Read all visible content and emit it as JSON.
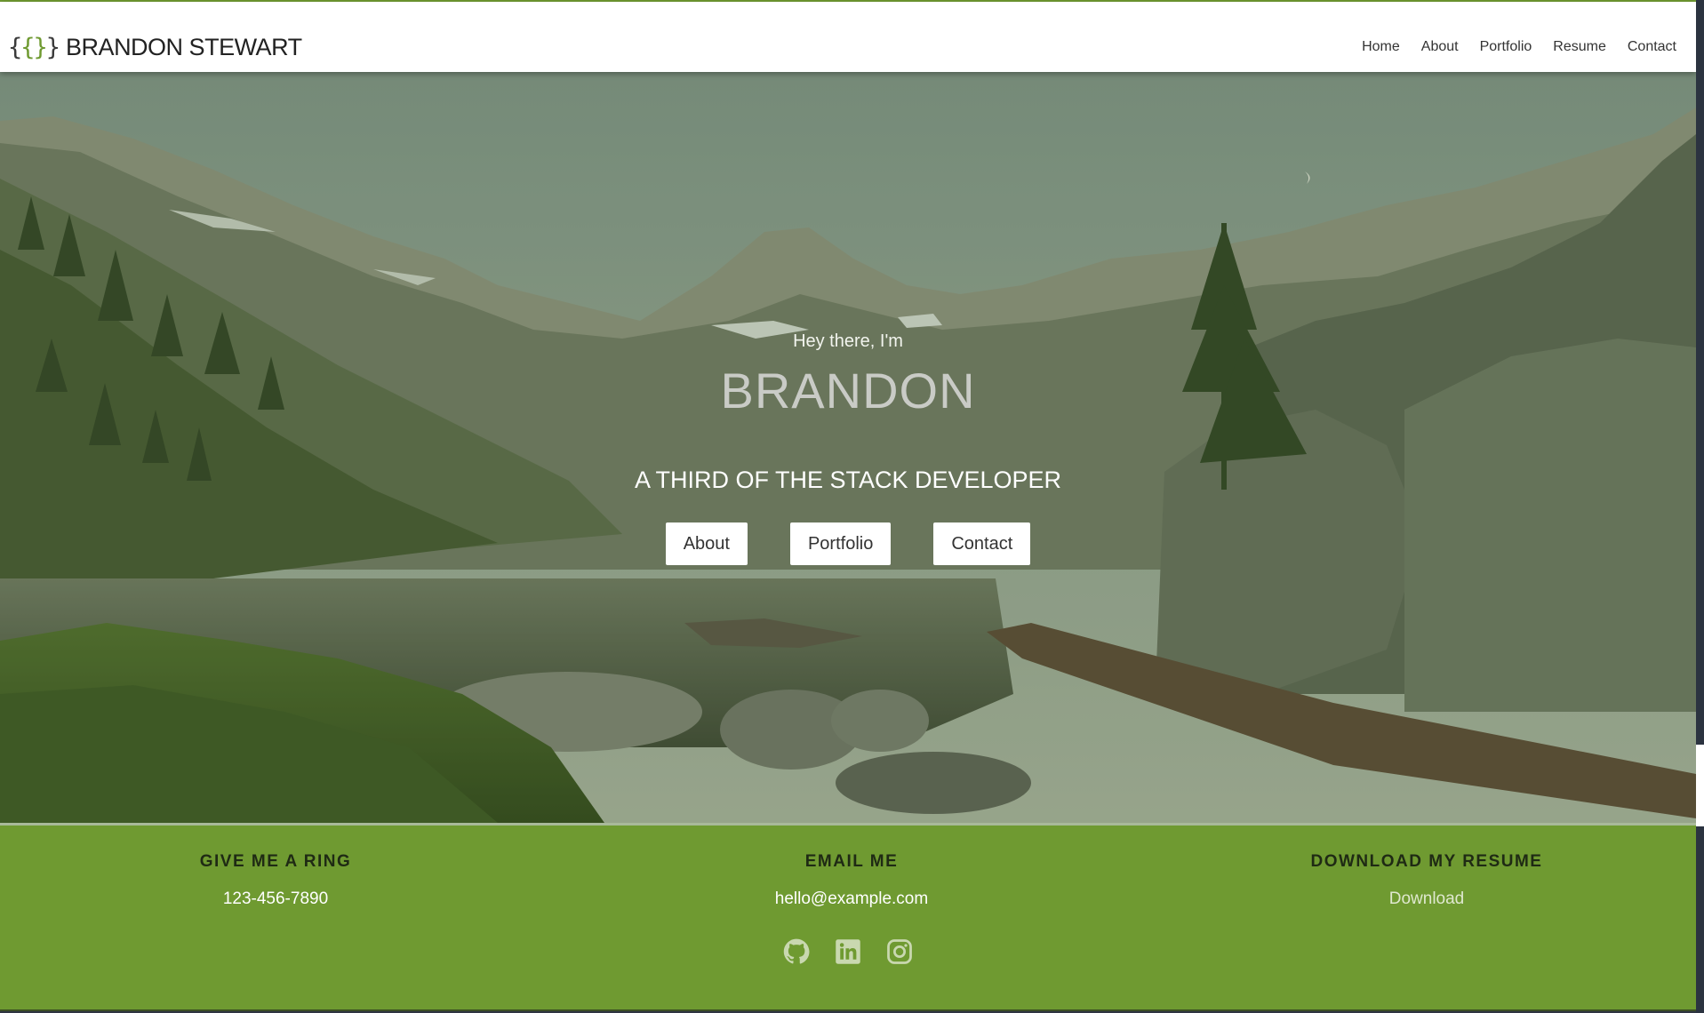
{
  "brand": {
    "logo_left": "{",
    "logo_mid": "{}",
    "logo_right": "}",
    "name": "BRANDON STEWART"
  },
  "nav": {
    "items": [
      "Home",
      "About",
      "Portfolio",
      "Resume",
      "Contact"
    ]
  },
  "hero": {
    "greeting": "Hey there, I'm",
    "name": "BRANDON",
    "tagline": "A THIRD OF THE STACK DEVELOPER",
    "buttons": [
      "About",
      "Portfolio",
      "Contact"
    ]
  },
  "footer": {
    "phone": {
      "title": "GIVE ME A RING",
      "value": "123-456-7890"
    },
    "email": {
      "title": "EMAIL ME",
      "value": "hello@example.com"
    },
    "resume": {
      "title": "DOWNLOAD MY RESUME",
      "link": "Download"
    },
    "social_icons": [
      "github-icon",
      "linkedin-icon",
      "instagram-icon"
    ]
  },
  "colors": {
    "accent_green": "#6f9a31",
    "nav_bg": "#ffffff",
    "button_bg": "#ffffff"
  }
}
